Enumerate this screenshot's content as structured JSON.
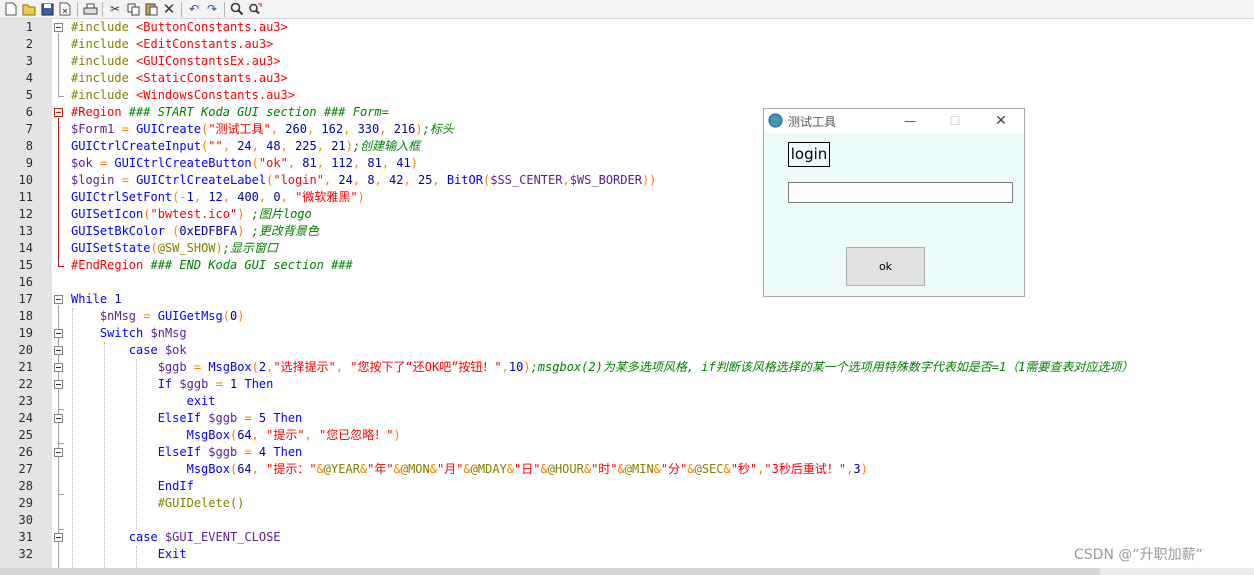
{
  "toolbar": {
    "items": [
      "new-file",
      "open-file",
      "save",
      "save-as",
      "print",
      "cut",
      "copy",
      "paste",
      "delete",
      "undo",
      "redo",
      "find",
      "replace"
    ]
  },
  "editor": {
    "line_numbers": [
      "1",
      "2",
      "3",
      "4",
      "5",
      "6",
      "7",
      "8",
      "9",
      "10",
      "11",
      "12",
      "13",
      "14",
      "15",
      "16",
      "17",
      "18",
      "19",
      "20",
      "21",
      "22",
      "23",
      "24",
      "25",
      "26",
      "27",
      "28",
      "29",
      "30",
      "31",
      "32"
    ],
    "lines": [
      "#include <ButtonConstants.au3>",
      "#include <EditConstants.au3>",
      "#include <GUIConstantsEx.au3>",
      "#include <StaticConstants.au3>",
      "#include <WindowsConstants.au3>",
      "#Region ### START Koda GUI section ### Form=",
      "$Form1 = GUICreate(\"测试工具\", 260, 162, 330, 216);标头",
      "GUICtrlCreateInput(\"\", 24, 48, 225, 21);创建输入框",
      "$ok = GUICtrlCreateButton(\"ok\", 81, 112, 81, 41)",
      "$login = GUICtrlCreateLabel(\"login\", 24, 8, 42, 25, BitOR($SS_CENTER,$WS_BORDER))",
      "GUICtrlSetFont(-1, 12, 400, 0, \"微软雅黑\")",
      "GUISetIcon(\"bwtest.ico\") ;图片logo",
      "GUISetBkColor (0xEDFBFA) ;更改背景色",
      "GUISetState(@SW_SHOW);显示窗口",
      "#EndRegion ### END Koda GUI section ###",
      "",
      "While 1",
      "    $nMsg = GUIGetMsg(0)",
      "    Switch $nMsg",
      "        case $ok",
      "            $ggb = MsgBox(2,\"选择提示\", \"您按下了“还OK吧”按钮！\",10);msgbox(2)为某多选项风格, if判断该风格选择的某一个选项用特殊数字代表如是否=1（1需要查表对应选项）",
      "            If $ggb = 1 Then",
      "                exit",
      "            ElseIf $ggb = 5 Then",
      "                MsgBox(64, \"提示\", \"您已忽略！\")",
      "            ElseIf $ggb = 4 Then",
      "                MsgBox(64, \"提示：\"&@YEAR&\"年\"&@MON&\"月\"&@MDAY&\"日\"&@HOUR&\"时\"&@MIN&\"分\"&@SEC&\"秒\",\"3秒后重试！\",3)",
      "            EndIf",
      "            #GUIDelete()",
      "",
      "        case $GUI_EVENT_CLOSE",
      "            Exit"
    ]
  },
  "dialog": {
    "title": "测试工具",
    "label": "login",
    "input_value": "",
    "button_label": "ok",
    "background": "#edfbfa"
  },
  "watermark": "CSDN @“升职加薪“",
  "colors": {
    "keyword": "#0000ff",
    "string": "#ff0000",
    "comment": "#008000",
    "number": "#0000a0",
    "variable": "#5a1e96",
    "gutter": "#e4e4e4"
  }
}
